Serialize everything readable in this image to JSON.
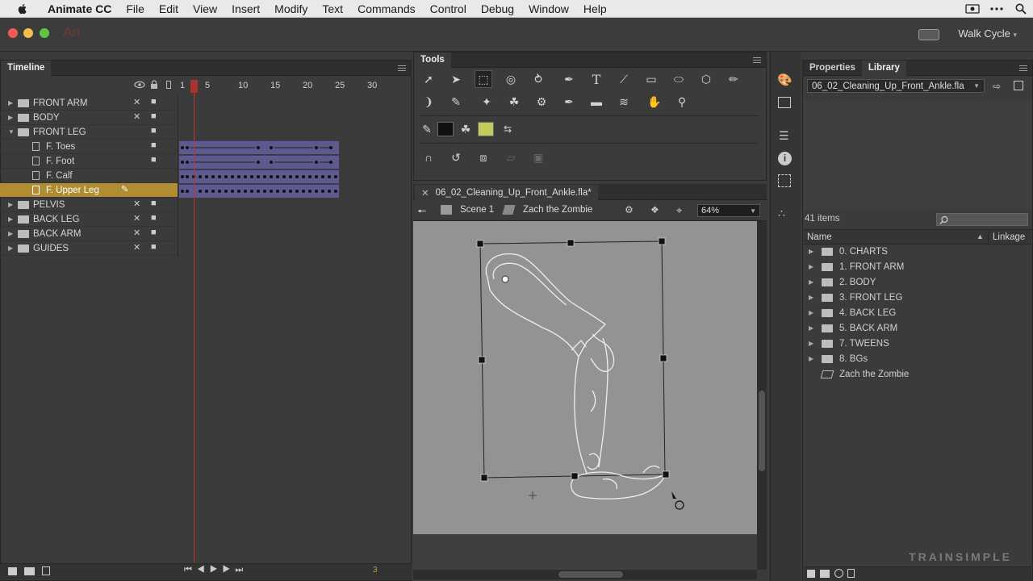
{
  "menubar": {
    "app_name": "Animate CC",
    "items": [
      "File",
      "Edit",
      "View",
      "Insert",
      "Modify",
      "Text",
      "Commands",
      "Control",
      "Debug",
      "Window",
      "Help"
    ]
  },
  "titlebar": {
    "app_logo": "An",
    "workspace": "Walk Cycle"
  },
  "timeline": {
    "title": "Timeline",
    "ruler": [
      "1",
      "5",
      "10",
      "15",
      "20",
      "25",
      "30"
    ],
    "layers": [
      {
        "name": "FRONT ARM",
        "type": "folder",
        "expanded": false
      },
      {
        "name": "BODY",
        "type": "folder",
        "expanded": false
      },
      {
        "name": "FRONT LEG",
        "type": "folder",
        "expanded": true
      },
      {
        "name": "F. Toes",
        "type": "layer"
      },
      {
        "name": "F. Foot",
        "type": "layer"
      },
      {
        "name": "F. Calf",
        "type": "layer"
      },
      {
        "name": "F. Upper Leg",
        "type": "layer",
        "selected": true
      },
      {
        "name": "PELVIS",
        "type": "folder",
        "expanded": false
      },
      {
        "name": "BACK LEG",
        "type": "folder",
        "expanded": false
      },
      {
        "name": "BACK ARM",
        "type": "folder",
        "expanded": false
      },
      {
        "name": "GUIDES",
        "type": "folder",
        "expanded": false
      }
    ],
    "current_frame": "3"
  },
  "tools": {
    "title": "Tools"
  },
  "document": {
    "tab_name": "06_02_Cleaning_Up_Front_Ankle.fla*",
    "scene": "Scene 1",
    "symbol": "Zach the Zombie",
    "zoom": "64%"
  },
  "library": {
    "tabs": [
      "Properties",
      "Library"
    ],
    "file": "06_02_Cleaning_Up_Front_Ankle.fla",
    "count": "41 items",
    "col_name": "Name",
    "col_linkage": "Linkage",
    "items": [
      {
        "name": "0. CHARTS",
        "type": "folder"
      },
      {
        "name": "1. FRONT ARM",
        "type": "folder"
      },
      {
        "name": "2. BODY",
        "type": "folder"
      },
      {
        "name": "3. FRONT LEG",
        "type": "folder"
      },
      {
        "name": "4. BACK LEG",
        "type": "folder"
      },
      {
        "name": "5. BACK ARM",
        "type": "folder"
      },
      {
        "name": "7. TWEENS",
        "type": "folder"
      },
      {
        "name": "8. BGs",
        "type": "folder"
      },
      {
        "name": "Zach the Zombie",
        "type": "symbol"
      }
    ]
  },
  "watermark": "TRAINSIMPLE",
  "colors": {
    "selected_layer": "#b08c33",
    "frames": "#5c5a8e",
    "playhead": "#c9302c",
    "stage": "#939393"
  }
}
